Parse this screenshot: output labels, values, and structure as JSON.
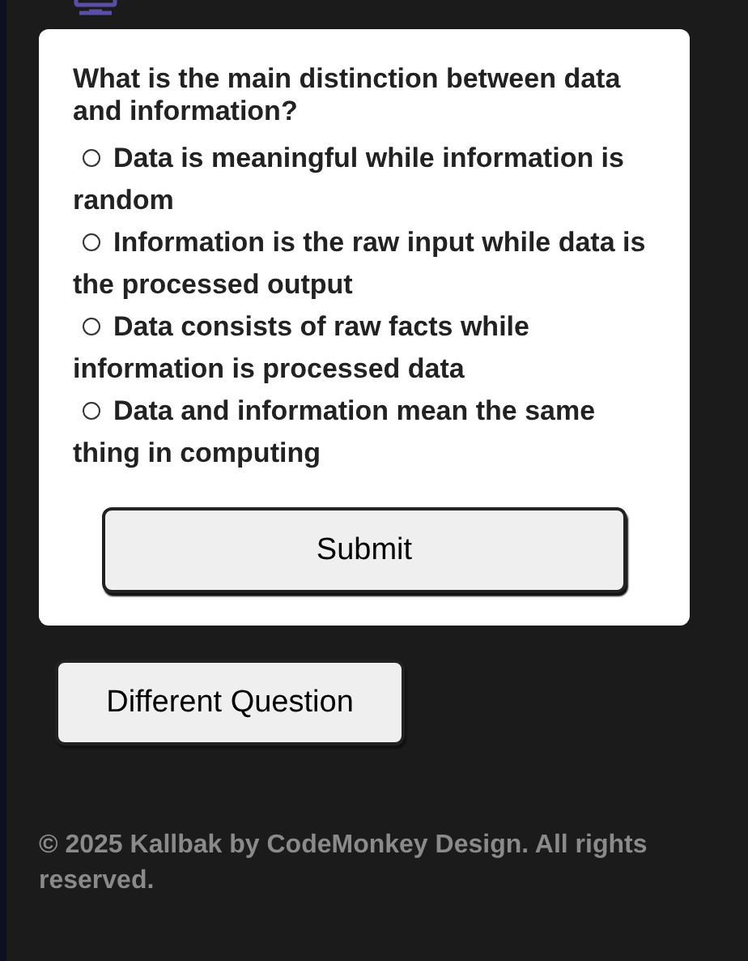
{
  "quiz": {
    "question": "What is the main distinction between data and information?",
    "options": [
      {
        "label": "Data is meaningful while information is random",
        "selected": false
      },
      {
        "label": "Information is the raw input while data is the processed output",
        "selected": false
      },
      {
        "label": "Data consists of raw facts while information is processed data",
        "selected": false
      },
      {
        "label": "Data and information mean the same thing in computing",
        "selected": false
      }
    ],
    "submit": "Submit"
  },
  "other_button": "Different Question",
  "footer": "© 2025 Kallbak by CodeMonkey Design. All rights reserved."
}
